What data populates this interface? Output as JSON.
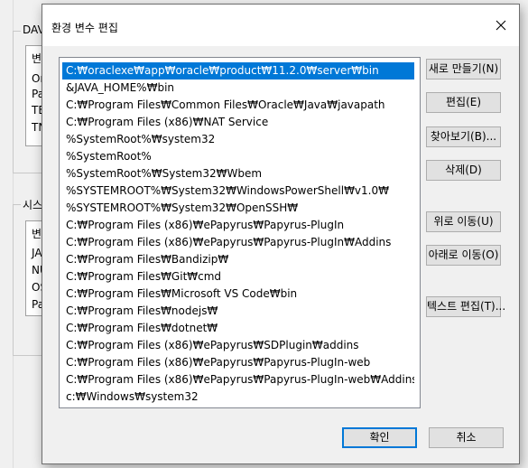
{
  "background": {
    "user_group_title": "DAV",
    "user_rows": [
      "변",
      "On",
      "Pa",
      "TE",
      "TN"
    ],
    "system_group_title": "시스",
    "system_rows": [
      "변",
      "JA",
      "NU",
      "OS",
      "Pa"
    ]
  },
  "dialog": {
    "title": "환경 변수 편집",
    "close_icon": "close-icon",
    "selected_index": 0,
    "paths": [
      "C:₩oraclexe₩app₩oracle₩product₩11.2.0₩server₩bin",
      "&JAVA_HOME%₩bin",
      "C:₩Program Files₩Common Files₩Oracle₩Java₩javapath",
      "C:₩Program Files (x86)₩NAT Service",
      "%SystemRoot%₩system32",
      "%SystemRoot%",
      "%SystemRoot%₩System32₩Wbem",
      "%SYSTEMROOT%₩System32₩WindowsPowerShell₩v1.0₩",
      "%SYSTEMROOT%₩System32₩OpenSSH₩",
      "C:₩Program Files (x86)₩ePapyrus₩Papyrus-PlugIn",
      "C:₩Program Files (x86)₩ePapyrus₩Papyrus-PlugIn₩Addins",
      "C:₩Program Files₩Bandizip₩",
      "C:₩Program Files₩Git₩cmd",
      "C:₩Program Files₩Microsoft VS Code₩bin",
      "C:₩Program Files₩nodejs₩",
      "C:₩Program Files₩dotnet₩",
      "C:₩Program Files (x86)₩ePapyrus₩SDPlugin₩addins",
      "C:₩Program Files (x86)₩ePapyrus₩Papyrus-PlugIn-web",
      "C:₩Program Files (x86)₩ePapyrus₩Papyrus-PlugIn-web₩Addins",
      "c:₩Windows₩system32"
    ],
    "buttons": {
      "new": "새로 만들기(N)",
      "edit": "편집(E)",
      "browse": "찾아보기(B)...",
      "delete": "삭제(D)",
      "move_up": "위로 이동(U)",
      "move_down": "아래로 이동(O)",
      "edit_text": "텍스트 편집(T)...",
      "ok": "확인",
      "cancel": "취소"
    }
  }
}
